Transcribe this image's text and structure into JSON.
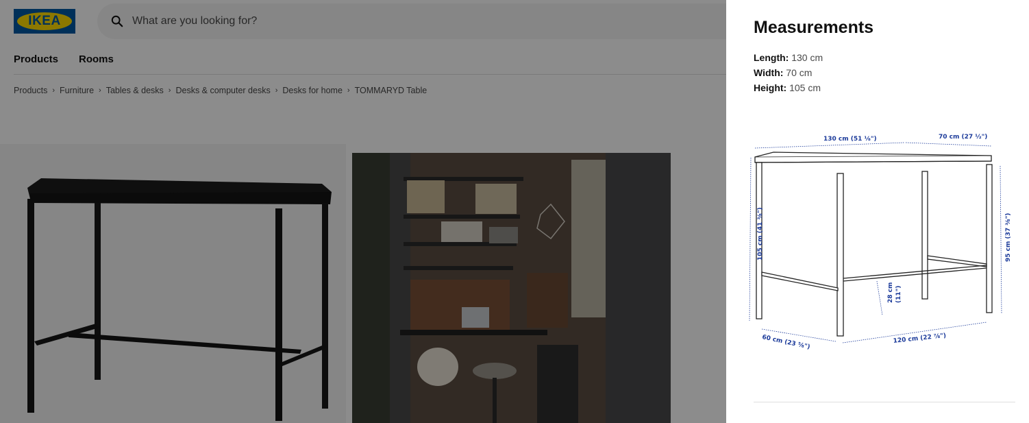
{
  "header": {
    "logo_text": "IKEA",
    "search_placeholder": "What are you looking for?"
  },
  "nav": {
    "items": [
      "Products",
      "Rooms"
    ]
  },
  "breadcrumb": [
    "Products",
    "Furniture",
    "Tables & desks",
    "Desks & computer desks",
    "Desks for home",
    "TOMMARYD Table"
  ],
  "modal": {
    "title": "Measurements",
    "length_label": "Length:",
    "length_value": " 130 cm",
    "width_label": "Width:",
    "width_value": " 70 cm",
    "height_label": "Height:",
    "height_value": " 105 cm",
    "diagram_labels": {
      "top_length": "130 cm (51 ⅛\")",
      "top_width": "70 cm (27 ½\")",
      "height_total": "105 cm (41 ⅜\")",
      "height_footrest": "95 cm (37 ⅜\")",
      "rail_height": "28 cm",
      "rail_height_in": "(11\")",
      "base_depth": "60 cm (23 ⅝\")",
      "base_length": "120 cm (22 ⅞\")"
    }
  },
  "colors": {
    "ikea_blue": "#0058a3",
    "ikea_yellow": "#ffdb00",
    "dim_blue": "#1b3a9a"
  }
}
